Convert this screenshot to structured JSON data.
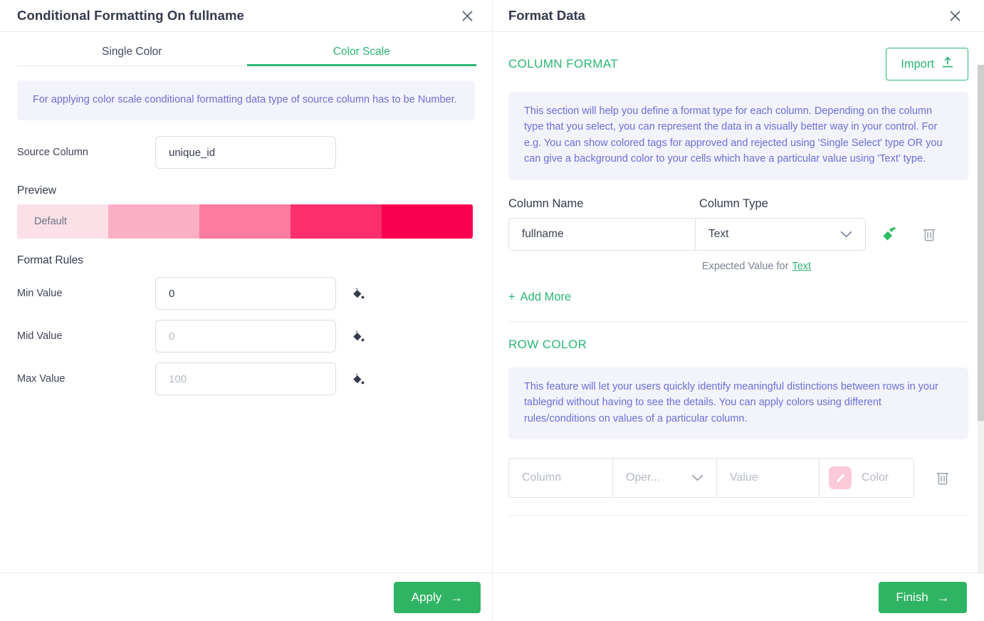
{
  "left": {
    "title": "Conditional Formatting On fullname",
    "close_icon": "close-icon",
    "tabs": [
      {
        "label": "Single Color",
        "active": false
      },
      {
        "label": "Color Scale",
        "active": true
      }
    ],
    "info_text": "For applying color scale conditional formatting data type of source column has to be Number.",
    "source_column": {
      "label": "Source Column",
      "value": "unique_id",
      "placeholder": ""
    },
    "preview": {
      "label": "Preview",
      "default_label": "Default",
      "swatches": [
        "#fce0e8",
        "#fbafc4",
        "#fc7ba0",
        "#fb2f6e",
        "#fa0050"
      ]
    },
    "format_rules": {
      "label": "Format Rules",
      "rows": [
        {
          "label": "Min Value",
          "value": "0",
          "placeholder": "",
          "icon": "paint-bucket-icon"
        },
        {
          "label": "Mid Value",
          "value": "",
          "placeholder": "0",
          "icon": "paint-bucket-icon"
        },
        {
          "label": "Max Value",
          "value": "",
          "placeholder": "100",
          "icon": "paint-bucket-icon"
        }
      ]
    },
    "footer": {
      "apply_label": "Apply",
      "arrow": "→"
    }
  },
  "right": {
    "title": "Format Data",
    "close_icon": "close-icon",
    "column_format": {
      "title": "COLUMN FORMAT",
      "import_label": "Import",
      "info_text": "This section will help you define a format type for each column. Depending on the column type that you select, you can represent the data in a visually better way in your control. For e.g. You can show colored tags for approved and rejected using 'Single Select' type OR you can give a background color to your cells which have a particular value using 'Text' type.",
      "headers": {
        "name": "Column Name",
        "type": "Column Type"
      },
      "rows": [
        {
          "name": "fullname",
          "type": "Text",
          "expected_prefix": "Expected Value for",
          "expected_link": "Text"
        }
      ],
      "add_more_label": "Add More",
      "add_more_plus": "+"
    },
    "row_color": {
      "title": "ROW COLOR",
      "info_text": "This feature will let your users quickly identify meaningful distinctions between rows in your tablegrid without having to see the details. You can apply colors using different rules/conditions on values of a particular column.",
      "rule": {
        "column_placeholder": "Column",
        "operator_placeholder": "Oper...",
        "value_placeholder": "Value",
        "color_label": "Color",
        "swatch_color": "#fcc9d9"
      }
    },
    "footer": {
      "finish_label": "Finish",
      "arrow": "→"
    }
  },
  "theme": {
    "accent_green": "#2bb673",
    "button_green": "#2fb464",
    "info_bg": "#f3f3fc",
    "info_text": "#6c6fd6",
    "title_color": "#34394e"
  }
}
